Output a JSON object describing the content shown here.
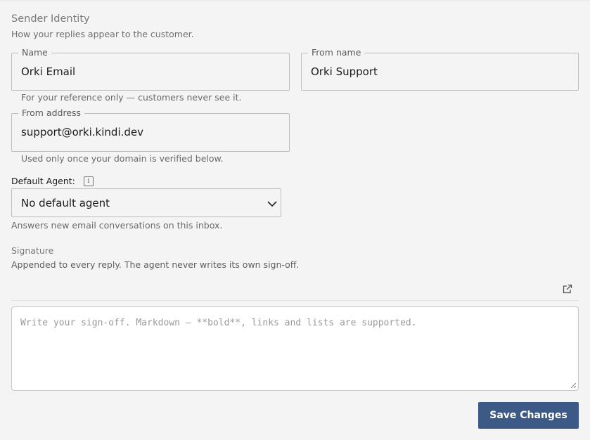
{
  "section": {
    "title": "Sender Identity",
    "subtitle": "How your replies appear to the customer."
  },
  "fields": {
    "name": {
      "label": "Name",
      "value": "Orki Email",
      "help": "For your reference only — customers never see it."
    },
    "from_name": {
      "label": "From name",
      "value": "Orki Support"
    },
    "from_address": {
      "label": "From address",
      "value": "support@orki.kindi.dev",
      "help": "Used only once your domain is verified below."
    }
  },
  "default_agent": {
    "label": "Default Agent:",
    "info_icon": "info-icon",
    "selected": "No default agent",
    "help": "Answers new email conversations on this inbox."
  },
  "signature": {
    "title": "Signature",
    "subtitle": "Appended to every reply. The agent never writes its own sign-off.",
    "open_icon": "external-link-icon",
    "placeholder": "Write your sign-off. Markdown — **bold**, links and lists are supported."
  },
  "actions": {
    "save_label": "Save Changes"
  },
  "colors": {
    "primary_button": "#3c5a85",
    "background": "#f4f4f4"
  }
}
